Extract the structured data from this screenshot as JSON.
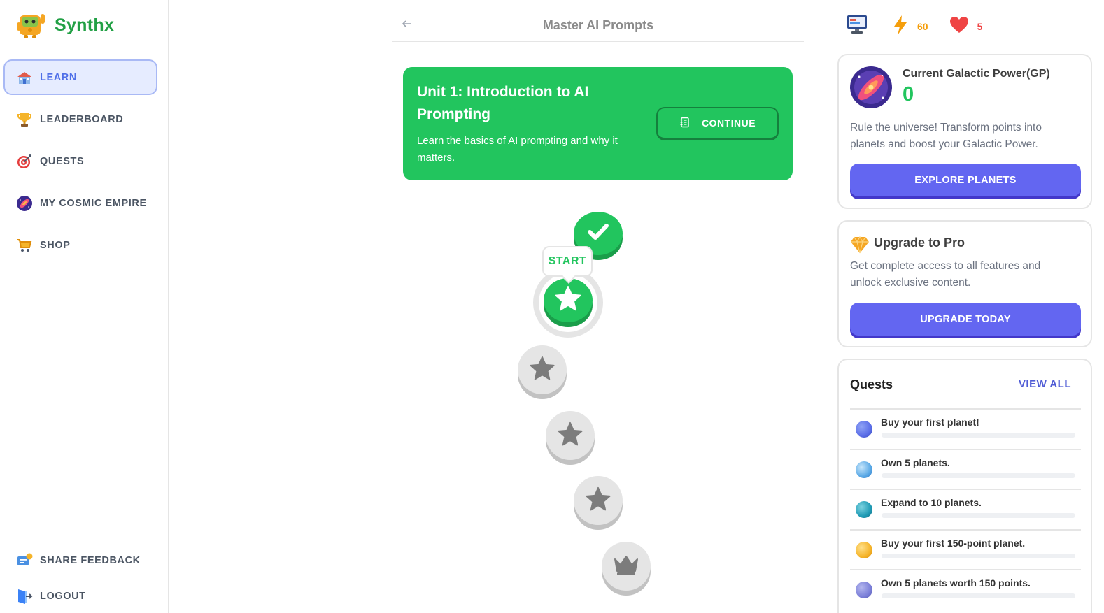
{
  "app": {
    "name": "Synthx"
  },
  "sidebar": {
    "items": [
      {
        "label": "LEARN",
        "icon": "school-icon",
        "active": true
      },
      {
        "label": "LEADERBOARD",
        "icon": "trophy-icon",
        "active": false
      },
      {
        "label": "QUESTS",
        "icon": "target-icon",
        "active": false
      },
      {
        "label": "MY COSMIC EMPIRE",
        "icon": "galaxy-icon",
        "active": false
      },
      {
        "label": "SHOP",
        "icon": "cart-icon",
        "active": false
      }
    ],
    "bottom": [
      {
        "label": "SHARE FEEDBACK",
        "icon": "feedback-icon"
      },
      {
        "label": "LOGOUT",
        "icon": "logout-icon"
      }
    ]
  },
  "header": {
    "title": "Master AI Prompts"
  },
  "unit": {
    "title": "Unit 1: Introduction to AI Prompting",
    "description": "Learn the basics of AI prompting and why it matters.",
    "continue_label": "CONTINUE"
  },
  "path": {
    "start_label": "START",
    "nodes": [
      {
        "state": "completed",
        "icon": "check-icon"
      },
      {
        "state": "current",
        "icon": "star-icon"
      },
      {
        "state": "locked",
        "icon": "star-icon"
      },
      {
        "state": "locked",
        "icon": "star-icon"
      },
      {
        "state": "locked",
        "icon": "star-icon"
      },
      {
        "state": "locked",
        "icon": "crown-icon"
      }
    ]
  },
  "stats": {
    "energy": "60",
    "hearts": "5",
    "colors": {
      "energy": "#f59e0b",
      "hearts": "#ef4444"
    }
  },
  "galactic_power": {
    "label": "Current Galactic Power(GP)",
    "value": "0",
    "description": "Rule the universe! Transform points into planets and boost your Galactic Power.",
    "button": "EXPLORE PLANETS"
  },
  "pro": {
    "title": "Upgrade to Pro",
    "description": "Get complete access to all features and unlock exclusive content.",
    "button": "UPGRADE TODAY"
  },
  "quests": {
    "title": "Quests",
    "view_all": "VIEW ALL",
    "items": [
      {
        "text": "Buy your first planet!",
        "progress": 0,
        "planet_color": "#5b6ee8"
      },
      {
        "text": "Own 5 planets.",
        "progress": 0,
        "planet_color": "#5aa9e6"
      },
      {
        "text": "Expand to 10 planets.",
        "progress": 0,
        "planet_color": "#1f9bb5"
      },
      {
        "text": "Buy your first 150-point planet.",
        "progress": 0,
        "planet_color": "#f5b42a"
      },
      {
        "text": "Own 5 planets worth 150 points.",
        "progress": 0,
        "planet_color": "#7b7fd8"
      }
    ]
  },
  "colors": {
    "brand": "#22a045",
    "primary": "#22c55e",
    "accent": "#6366f1"
  }
}
